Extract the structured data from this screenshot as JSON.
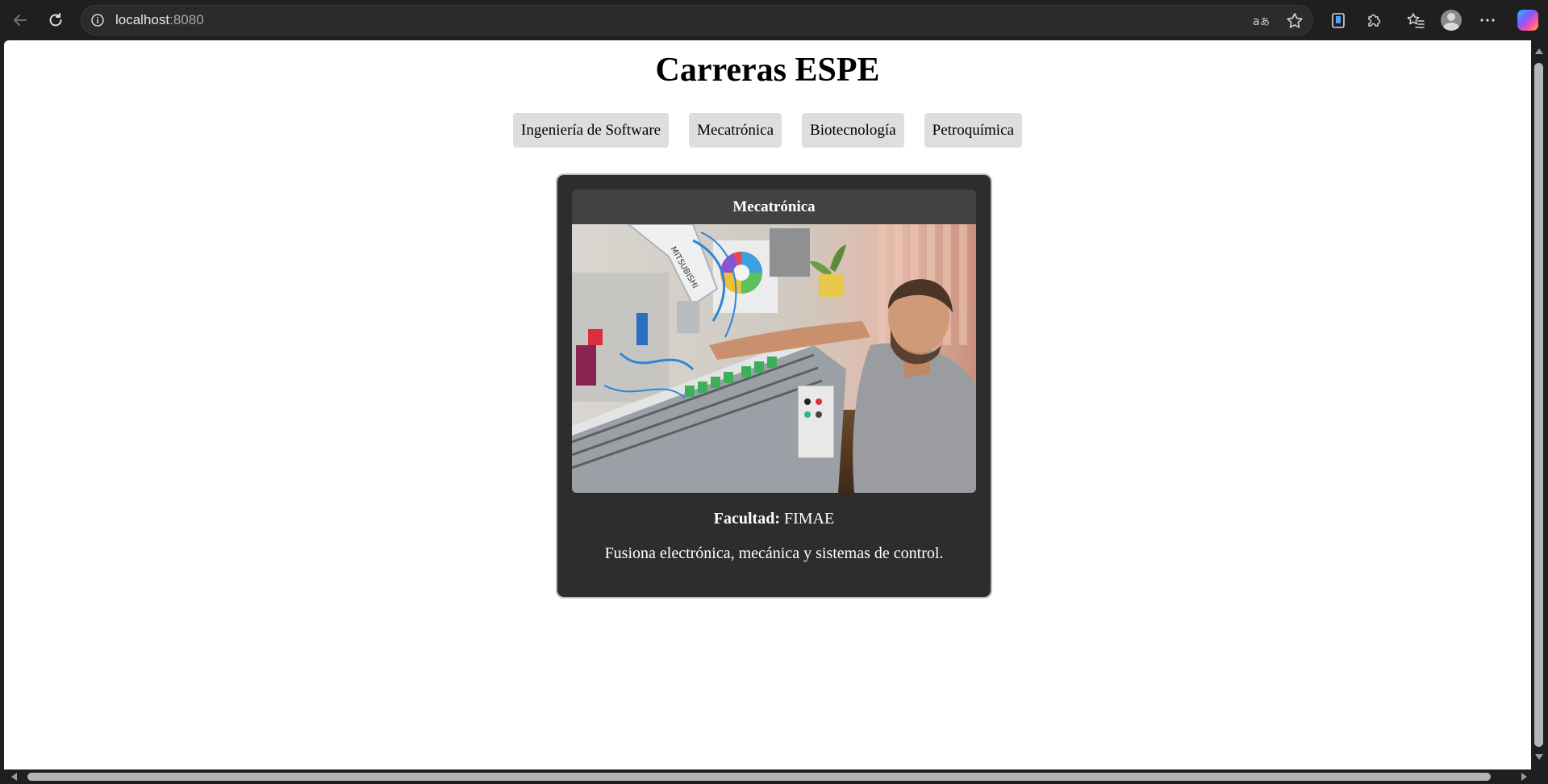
{
  "browser": {
    "url_host": "localhost",
    "url_port": ":8080"
  },
  "page": {
    "title": "Carreras ESPE",
    "nav": [
      {
        "label": "Ingeniería de Software"
      },
      {
        "label": "Mecatrónica"
      },
      {
        "label": "Biotecnología"
      },
      {
        "label": "Petroquímica"
      }
    ],
    "card": {
      "title": "Mecatrónica",
      "faculty_label": "Facultad:",
      "faculty_value": "FIMAE",
      "description": "Fusiona electrónica, mecánica y sistemas de control."
    }
  },
  "colors": {
    "card_bg": "#2d2d2d",
    "card_header_bg": "#424242",
    "nav_button_bg": "#dedede"
  }
}
